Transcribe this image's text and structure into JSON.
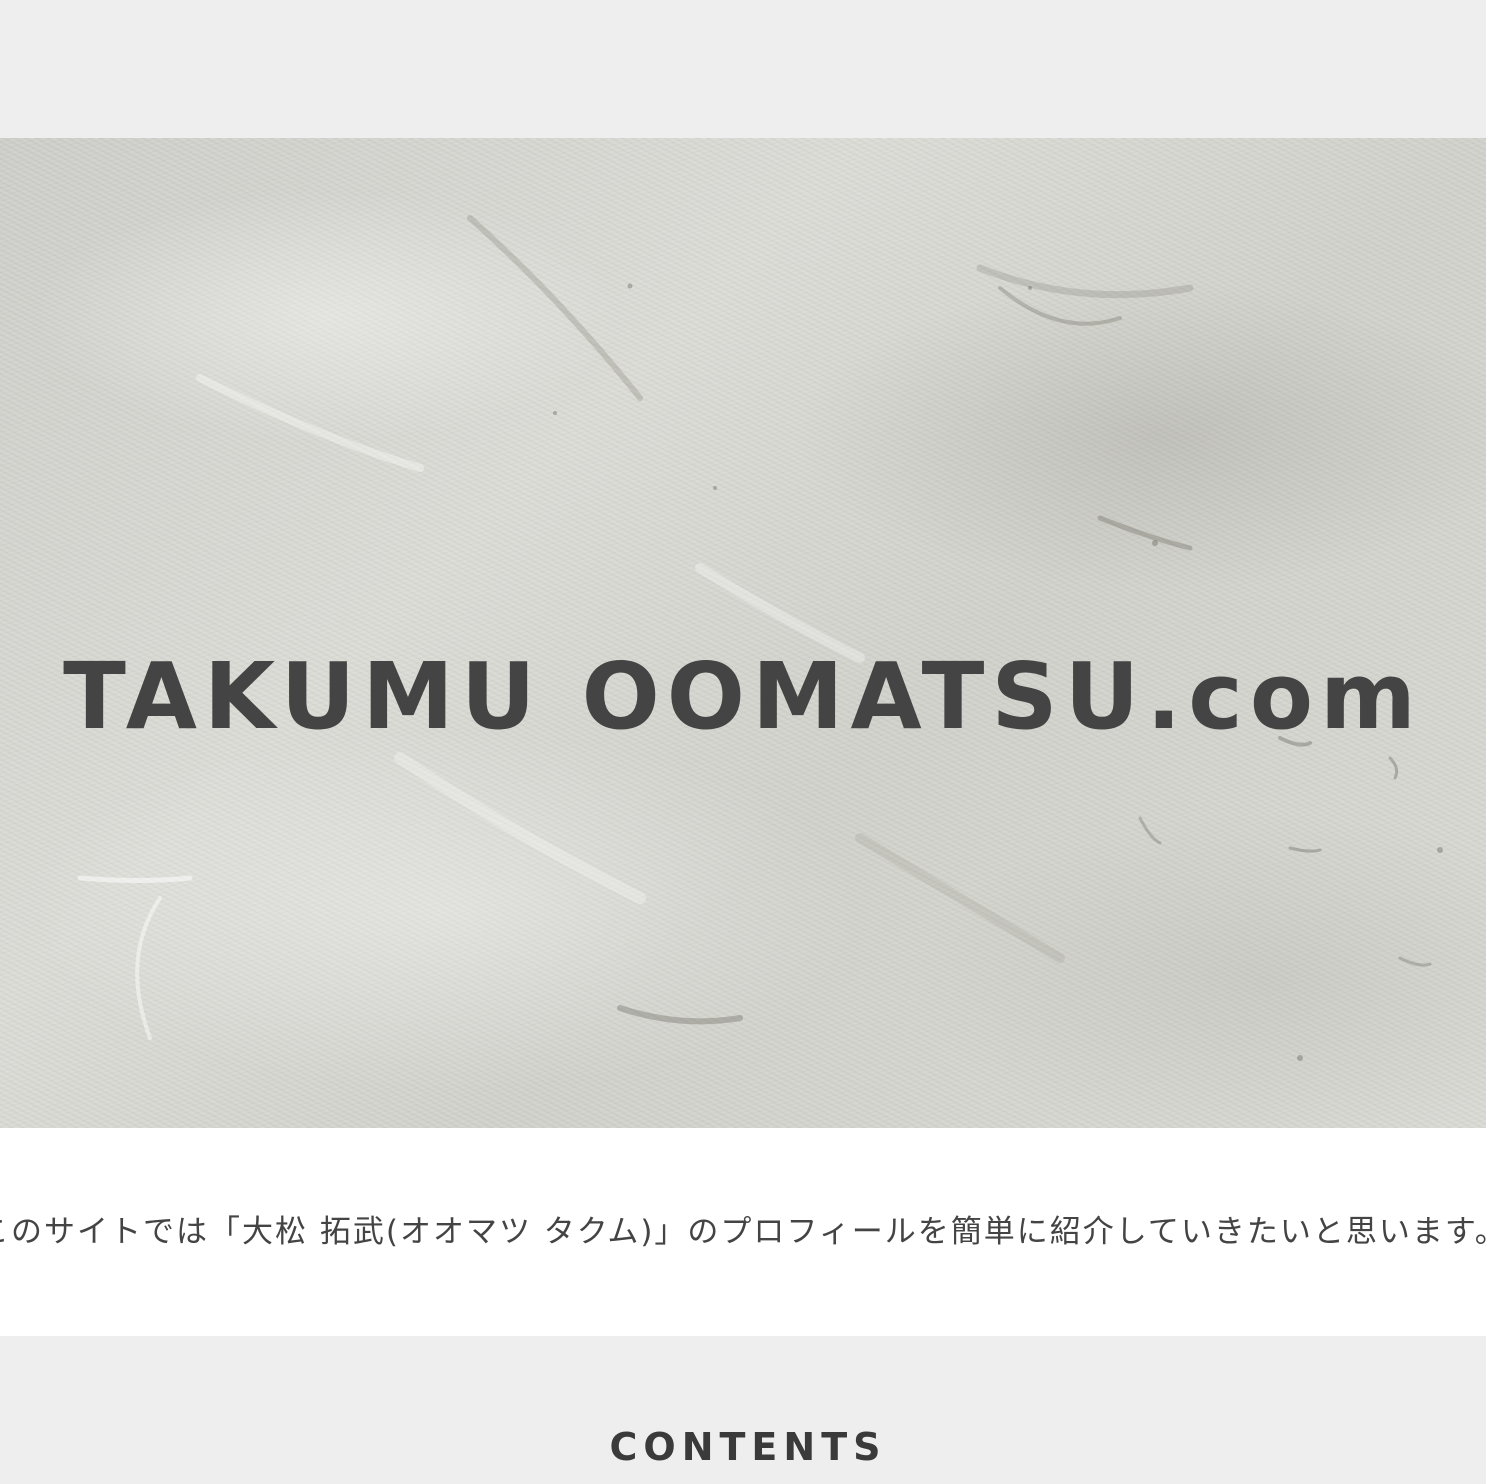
{
  "hero": {
    "title": "TAKUMU OOMATSU.com",
    "background": "white-plaster-texture"
  },
  "intro": {
    "text": "このサイトでは「大松 拓武(オオマツ タクム)」のプロフィールを簡単に紹介していきたいと思います。"
  },
  "contents": {
    "heading": "CONTENTS"
  },
  "colors": {
    "page_bg": "#eeeeee",
    "intro_bg": "#ffffff",
    "text": "#444444"
  }
}
